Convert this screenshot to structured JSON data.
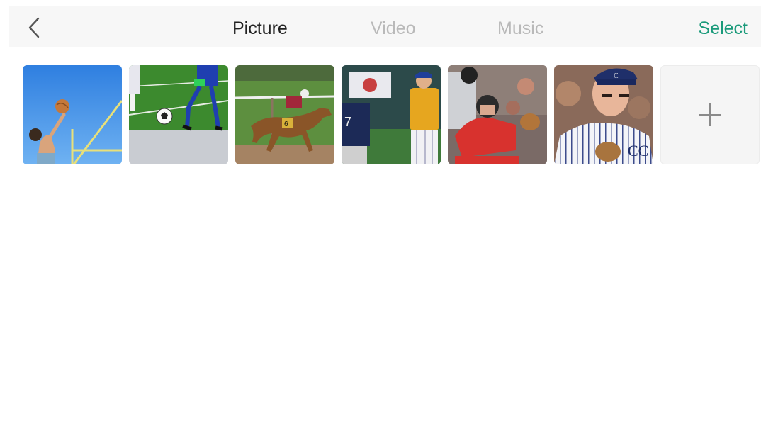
{
  "header": {
    "tabs": [
      {
        "label": "Picture",
        "active": true
      },
      {
        "label": "Video",
        "active": false
      },
      {
        "label": "Music",
        "active": false
      }
    ],
    "select_label": "Select"
  },
  "icons": {
    "back": "chevron-left-icon",
    "add": "plus-icon"
  },
  "thumbnails": [
    {
      "subject": "volleyball-player"
    },
    {
      "subject": "soccer-players"
    },
    {
      "subject": "horse-race"
    },
    {
      "subject": "baseball-batter"
    },
    {
      "subject": "softball-catcher"
    },
    {
      "subject": "baseball-player-portrait"
    }
  ],
  "colors": {
    "accent": "#1a9a7a",
    "tab_active": "#222222",
    "tab_inactive": "#b9b9b9",
    "header_bg": "#f7f7f7"
  }
}
